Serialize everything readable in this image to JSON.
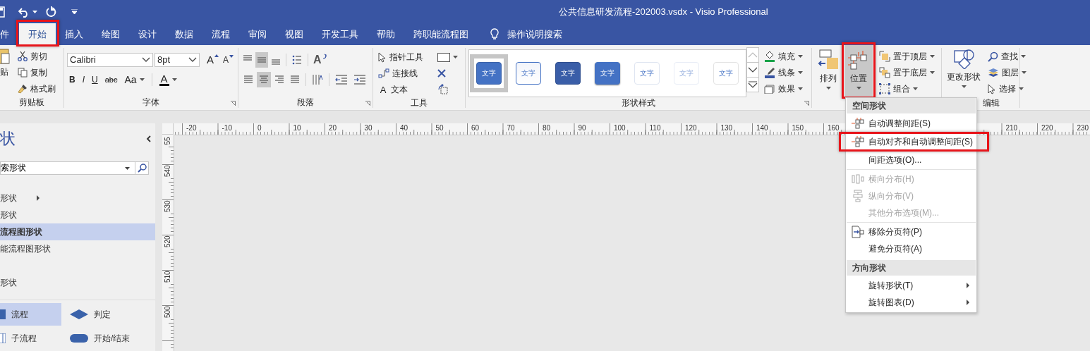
{
  "window": {
    "title": "公共信息研发流程-202003.vsdx  -  Visio Professional"
  },
  "tabs": [
    {
      "label": "件",
      "selected": false,
      "annotated": false
    },
    {
      "label": "开始",
      "selected": true,
      "annotated": true
    },
    {
      "label": "插入",
      "selected": false,
      "annotated": false
    },
    {
      "label": "绘图",
      "selected": false,
      "annotated": false
    },
    {
      "label": "设计",
      "selected": false,
      "annotated": false
    },
    {
      "label": "数据",
      "selected": false,
      "annotated": false
    },
    {
      "label": "流程",
      "selected": false,
      "annotated": false
    },
    {
      "label": "审阅",
      "selected": false,
      "annotated": false
    },
    {
      "label": "视图",
      "selected": false,
      "annotated": false
    },
    {
      "label": "开发工具",
      "selected": false,
      "annotated": false
    },
    {
      "label": "帮助",
      "selected": false,
      "annotated": false
    },
    {
      "label": "跨职能流程图",
      "selected": false,
      "annotated": false
    }
  ],
  "tell_me": {
    "label": "操作说明搜索"
  },
  "clipboard": {
    "label": "剪贴板",
    "paste": "贴",
    "items": [
      {
        "label": "剪切"
      },
      {
        "label": "复制"
      },
      {
        "label": "格式刷"
      }
    ]
  },
  "font": {
    "label": "字体",
    "name": "Calibri",
    "size": "8pt",
    "grow": "A",
    "shrink": "A",
    "bold": "B",
    "italic": "I",
    "underline": "U",
    "strikethrough": "abc",
    "case": "Aa",
    "color_button": "A"
  },
  "paragraph": {
    "label": "段落",
    "text_direction": "A"
  },
  "tools": {
    "label": "工具",
    "items": [
      {
        "label": "指针工具"
      },
      {
        "label": "连接线"
      },
      {
        "label": "文本",
        "glyph": "A"
      }
    ]
  },
  "shape_styles": {
    "label": "形状样式",
    "swatches": [
      {
        "text": "文字",
        "kind": "solid",
        "selected": true
      },
      {
        "text": "文字",
        "kind": "outline",
        "selected": false
      },
      {
        "text": "文字",
        "kind": "dark",
        "selected": false
      },
      {
        "text": "文字",
        "kind": "shaded",
        "selected": false
      },
      {
        "text": "文字",
        "kind": "subtle",
        "selected": false
      },
      {
        "text": "文字",
        "kind": "faint",
        "selected": false
      },
      {
        "text": "文字",
        "kind": "plain",
        "selected": false
      }
    ],
    "options": [
      {
        "label": "填充"
      },
      {
        "label": "线条"
      },
      {
        "label": "效果"
      }
    ]
  },
  "arrange": {
    "large": [
      {
        "label": "排列",
        "pressed": false,
        "annotated": false
      },
      {
        "label": "位置",
        "pressed": true,
        "annotated": true
      }
    ],
    "items": [
      {
        "label": "置于顶层"
      },
      {
        "label": "置于底层"
      },
      {
        "label": "组合"
      }
    ]
  },
  "editing": {
    "label": "编辑",
    "change_shape": "更改形状",
    "items": [
      {
        "label": "查找"
      },
      {
        "label": "图层"
      },
      {
        "label": "选择"
      }
    ]
  },
  "shapes_panel": {
    "title": "状",
    "search": "索形状",
    "stencils": [
      {
        "label": "形状",
        "selected": false,
        "submenu": true
      },
      {
        "label": "形状",
        "selected": false,
        "submenu": false
      },
      {
        "label": "流程图形状",
        "selected": true,
        "submenu": false
      },
      {
        "label": "能流程图形状",
        "selected": false,
        "submenu": false
      },
      {
        "label": "形状",
        "selected": false,
        "submenu": false
      }
    ],
    "masters": [
      {
        "label": "流程",
        "kind": "process",
        "selected": true
      },
      {
        "label": "判定",
        "kind": "decision",
        "selected": false
      },
      {
        "label": "子流程",
        "kind": "subprocess",
        "selected": false
      },
      {
        "label": "开始/结束",
        "kind": "terminator",
        "selected": false
      }
    ]
  },
  "ruler": {
    "horizontal": [
      "-20",
      "-10",
      "0",
      "10",
      "20",
      "30",
      "40",
      "50",
      "60",
      "70",
      "80",
      "90",
      "100",
      "110",
      "120",
      "130",
      "140",
      "150",
      "160",
      "210",
      "220",
      "230"
    ],
    "vertical": [
      "55",
      "540",
      "530",
      "520",
      "510",
      "500"
    ]
  },
  "menu": {
    "groups": [
      {
        "heading": "空间形状",
        "items": [
          {
            "label": "自动调整间距(S)",
            "disabled": false,
            "submenu": false,
            "annotated": false
          },
          {
            "label": "自动对齐和自动调整间距(S)",
            "disabled": false,
            "submenu": false,
            "annotated": true
          },
          {
            "label": "间距选项(O)...",
            "disabled": false,
            "submenu": false,
            "annotated": false
          }
        ]
      },
      {
        "items": [
          {
            "label": "横向分布(H)",
            "disabled": true,
            "submenu": false,
            "annotated": false
          },
          {
            "label": "纵向分布(V)",
            "disabled": true,
            "submenu": false,
            "annotated": false
          },
          {
            "label": "其他分布选项(M)...",
            "disabled": true,
            "submenu": false,
            "annotated": false
          }
        ]
      },
      {
        "items": [
          {
            "label": "移除分页符(P)",
            "disabled": false,
            "submenu": false,
            "annotated": false
          },
          {
            "label": "避免分页符(A)",
            "disabled": false,
            "submenu": false,
            "annotated": false
          }
        ]
      },
      {
        "heading": "方向形状",
        "items": [
          {
            "label": "旋转形状(T)",
            "disabled": false,
            "submenu": true,
            "annotated": false
          },
          {
            "label": "旋转图表(D)",
            "disabled": false,
            "submenu": true,
            "annotated": false
          }
        ]
      }
    ]
  }
}
